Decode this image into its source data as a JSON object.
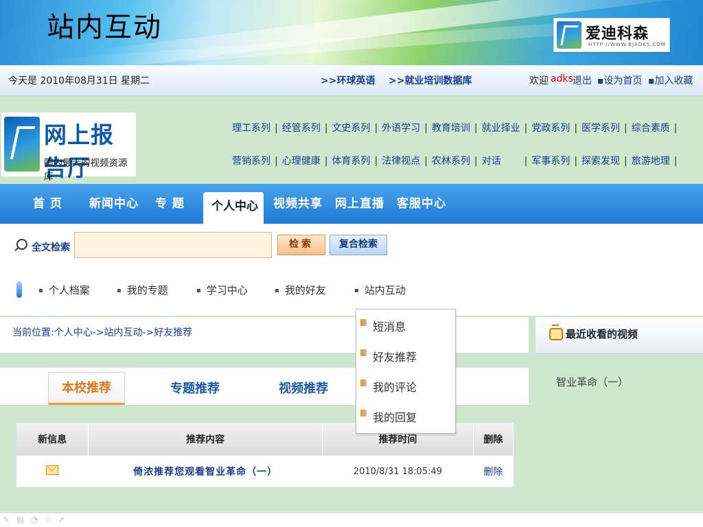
{
  "slide": {
    "title": "站内互动",
    "brand_name": "爱迪科森",
    "brand_url": "HTTP://WWW.BJADKS.COM"
  },
  "topbar": {
    "date_text": "今天是 2010年08月31日 星期二",
    "link_english": ">>环球英语",
    "link_jobdb": ">>就业培训数据库",
    "welcome_label": "欢迎",
    "username": "adks",
    "logout": "退出",
    "set_homepage": "▪设为首页",
    "add_favorite": "▪加入收藏"
  },
  "site_logo": {
    "name": "网上报告厅",
    "tagline": "国内最大的视频资源库"
  },
  "categories": {
    "row1": [
      "理工系列",
      "经管系列",
      "文史系列",
      "外语学习",
      "教育培训",
      "就业择业",
      "党政系列",
      "医学系列",
      "综合素质"
    ],
    "row2": [
      "营销系列",
      "心理健康",
      "体育系列",
      "法律视点",
      "农林系列",
      "对话",
      "军事系列",
      "探索发现",
      "旅游地理"
    ]
  },
  "mainnav": {
    "home": "首 页",
    "news": "新闻中心",
    "topics": "专 题",
    "personal": "个人中心",
    "video_share": "视频共享",
    "live": "网上直播",
    "service": "客服中心"
  },
  "search": {
    "label": "全文检索",
    "value": "",
    "button": "检索",
    "advanced_button": "复合检索"
  },
  "subnav": {
    "profile": "个人档案",
    "my_topics": "我的专题",
    "study_center": "学习中心",
    "friends": "我的好友",
    "interaction": "站内互动"
  },
  "dropdown": {
    "items": [
      "短消息",
      "好友推荐",
      "我的评论",
      "我的回复"
    ]
  },
  "breadcrumb": "当前位置:个人中心->站内互动->好友推荐",
  "tabs": {
    "school": "本校推荐",
    "topic": "专题推荐",
    "video": "视频推荐"
  },
  "table": {
    "headers": [
      "新信息",
      "推荐内容",
      "推荐时间",
      "删除"
    ],
    "rows": [
      {
        "content": "倚浓推荐您观看智业革命（一）",
        "time": "2010/8/31 18:05:49",
        "delete": "删除"
      }
    ]
  },
  "recent": {
    "title": "最近收看的视频",
    "items": [
      "智业革命（一）"
    ]
  },
  "colors": {
    "nav_blue": "#1f7ad4",
    "accent_orange": "#e2771a",
    "link_blue": "#1a3d8f",
    "username_red": "#dd0000",
    "panel_green": "#cfe7cf"
  }
}
